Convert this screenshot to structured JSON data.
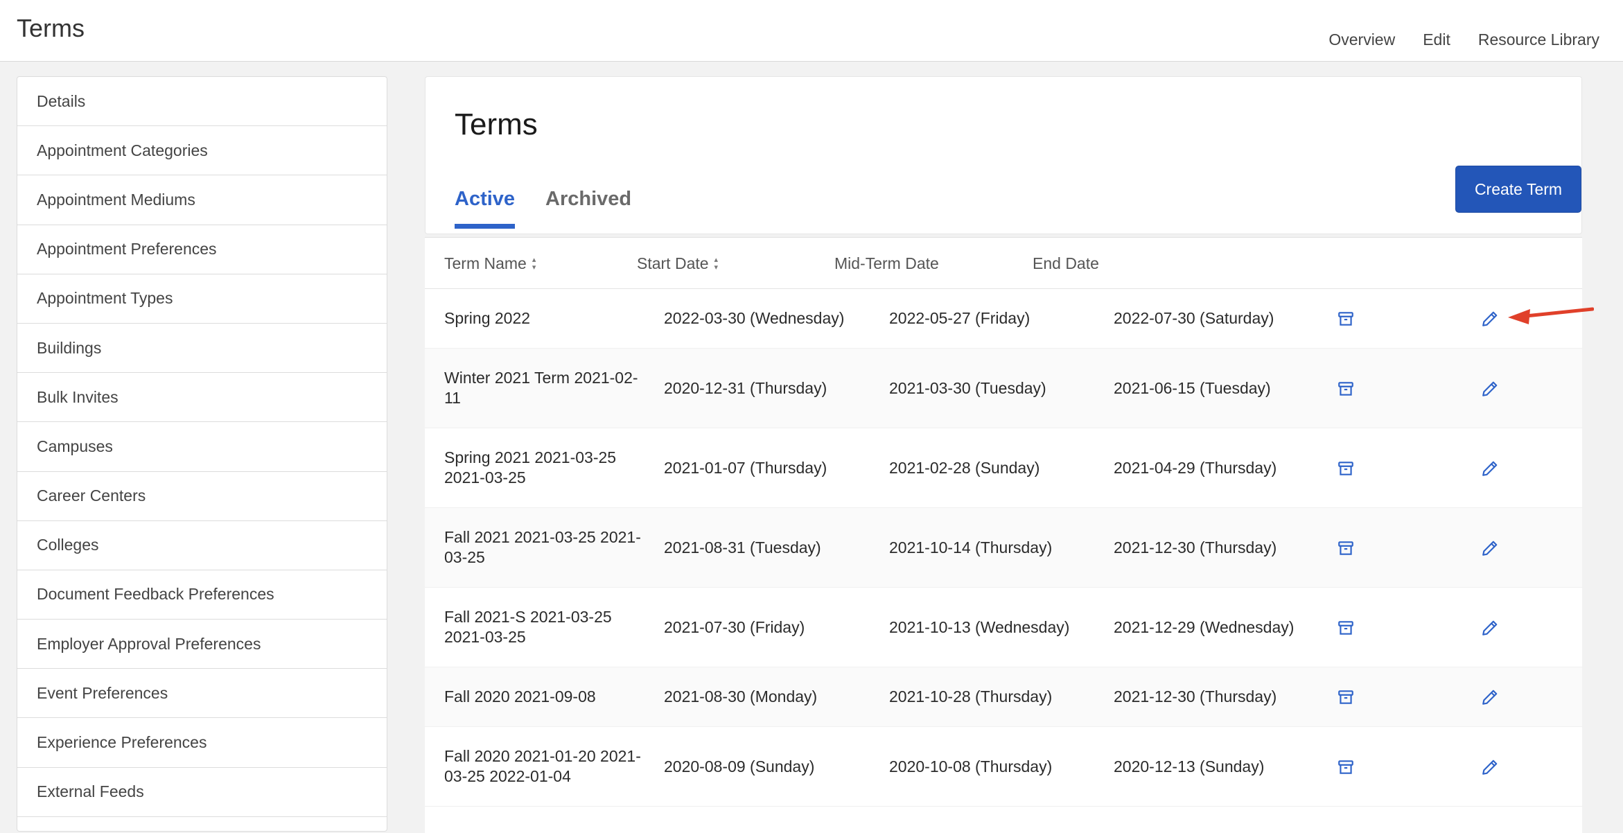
{
  "header": {
    "title": "Terms",
    "nav": [
      "Overview",
      "Edit",
      "Resource Library"
    ]
  },
  "sidebar": {
    "items": [
      "Details",
      "Appointment Categories",
      "Appointment Mediums",
      "Appointment Preferences",
      "Appointment Types",
      "Buildings",
      "Bulk Invites",
      "Campuses",
      "Career Centers",
      "Colleges",
      "Document Feedback Preferences",
      "Employer Approval Preferences",
      "Event Preferences",
      "Experience Preferences",
      "External Feeds"
    ]
  },
  "main": {
    "title": "Terms",
    "tabs": [
      "Active",
      "Archived"
    ],
    "active_tab": "Active",
    "create_button": "Create Term"
  },
  "table": {
    "columns": [
      "Term Name",
      "Start Date",
      "Mid-Term Date",
      "End Date"
    ],
    "rows": [
      {
        "name": "Spring 2022",
        "start": "2022-03-30 (Wednesday)",
        "mid": "2022-05-27 (Friday)",
        "end": "2022-07-30 (Saturday)"
      },
      {
        "name": "Winter 2021 Term 2021-02-11",
        "start": "2020-12-31 (Thursday)",
        "mid": "2021-03-30 (Tuesday)",
        "end": "2021-06-15 (Tuesday)"
      },
      {
        "name": "Spring 2021 2021-03-25 2021-03-25",
        "start": "2021-01-07 (Thursday)",
        "mid": "2021-02-28 (Sunday)",
        "end": "2021-04-29 (Thursday)"
      },
      {
        "name": "Fall 2021 2021-03-25 2021-03-25",
        "start": "2021-08-31 (Tuesday)",
        "mid": "2021-10-14 (Thursday)",
        "end": "2021-12-30 (Thursday)"
      },
      {
        "name": "Fall 2021-S 2021-03-25 2021-03-25",
        "start": "2021-07-30 (Friday)",
        "mid": "2021-10-13 (Wednesday)",
        "end": "2021-12-29 (Wednesday)"
      },
      {
        "name": "Fall 2020 2021-09-08",
        "start": "2021-08-30 (Monday)",
        "mid": "2021-10-28 (Thursday)",
        "end": "2021-12-30 (Thursday)"
      },
      {
        "name": "Fall 2020 2021-01-20 2021-03-25 2022-01-04",
        "start": "2020-08-09 (Sunday)",
        "mid": "2020-10-08 (Thursday)",
        "end": "2020-12-13 (Sunday)"
      }
    ]
  },
  "colors": {
    "accent": "#2e63c9",
    "button": "#2356b8",
    "annotation_arrow": "#e0402a"
  },
  "icons": {
    "archive": "archive-box-icon",
    "edit": "pencil-icon"
  }
}
